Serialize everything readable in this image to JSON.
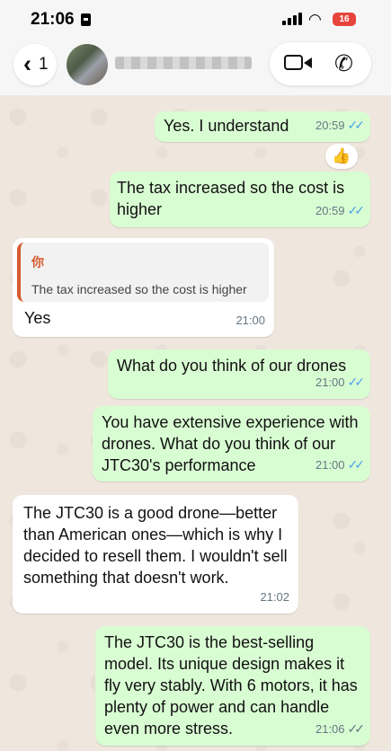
{
  "status_bar": {
    "time": "21:06",
    "battery": "16"
  },
  "header": {
    "back_count": "1"
  },
  "messages": [
    {
      "id": "m1",
      "direction": "out",
      "text": "Yes.  I understand",
      "time": "20:59",
      "status": "read"
    },
    {
      "id": "m2",
      "direction": "out",
      "text": "The tax increased so the cost is higher",
      "time": "20:59",
      "status": "read"
    },
    {
      "id": "m3",
      "direction": "in",
      "quote_author": "你",
      "quote_text": "The tax increased so the cost is higher",
      "text": "Yes",
      "time": "21:00"
    },
    {
      "id": "m4",
      "direction": "out",
      "text": "What do you think of our drones",
      "time": "21:00",
      "status": "read"
    },
    {
      "id": "m5",
      "direction": "out",
      "text": "You have extensive experience with drones. What do you think of our JTC30's performance",
      "time": "21:00",
      "status": "read"
    },
    {
      "id": "m6",
      "direction": "in",
      "text": "The JTC30 is a good drone—better than American ones—which is why I decided to resell them. I wouldn't sell something that doesn't work.",
      "time": "21:02"
    },
    {
      "id": "m7",
      "direction": "out",
      "text": "The JTC30 is the best-selling model. Its unique design makes it fly very stably. With 6 motors, it has plenty of power and can handle even more stress.",
      "time": "21:06",
      "status": "delivered"
    }
  ],
  "reaction": {
    "emoji": "👍"
  },
  "colors": {
    "outgoing_bubble": "#d9fdd3",
    "incoming_bubble": "#ffffff",
    "read_tick": "#4fa3e8",
    "quote_accent": "#d65b2c",
    "chat_background": "#efe7dd"
  }
}
